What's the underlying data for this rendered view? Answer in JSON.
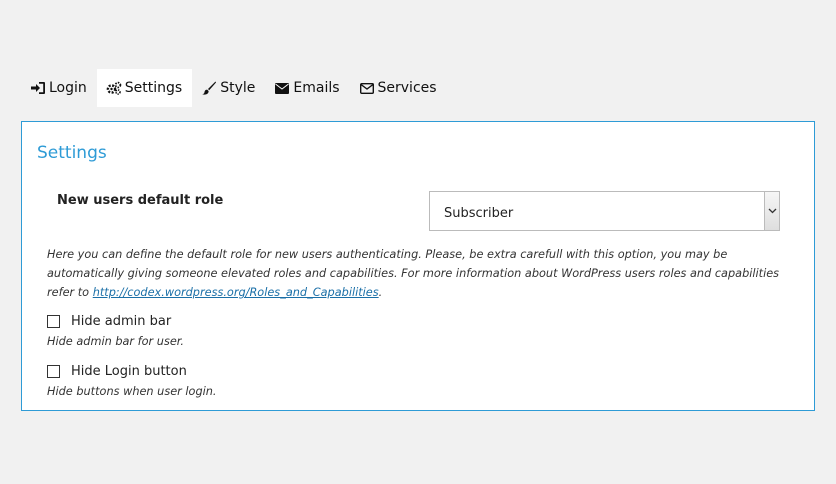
{
  "tabs": [
    {
      "label": "Login",
      "icon": "sign-in-icon",
      "active": false
    },
    {
      "label": "Settings",
      "icon": "cogs-icon",
      "active": true
    },
    {
      "label": "Style",
      "icon": "paint-brush-icon",
      "active": false
    },
    {
      "label": "Emails",
      "icon": "envelope-icon",
      "active": false
    },
    {
      "label": "Services",
      "icon": "envelope-outline-icon",
      "active": false
    }
  ],
  "panel": {
    "title": "Settings",
    "role_field": {
      "label": "New users default role",
      "value": "Subscriber"
    },
    "description": {
      "text": "Here you can define the default role for new users authenticating. Please, be extra carefull with this option, you may be automatically giving someone elevated roles and capabilities. For more information about WordPress users roles and capabilities refer to ",
      "link": "http://codex.wordpress.org/Roles_and_Capabilities",
      "suffix": "."
    },
    "hide_admin_bar": {
      "label": "Hide admin bar",
      "help": "Hide admin bar for user.",
      "checked": false
    },
    "hide_login_button": {
      "label": "Hide Login button",
      "help": "Hide buttons when user login.",
      "checked": false
    }
  },
  "colors": {
    "accent": "#2e9bd6",
    "background": "#f1f1f1"
  }
}
